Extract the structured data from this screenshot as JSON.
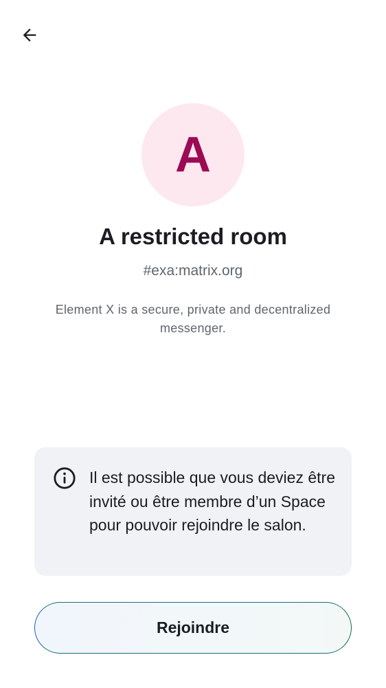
{
  "header": {
    "back_icon": "arrow-left-icon"
  },
  "room": {
    "avatar_letter": "A",
    "avatar_bg_color": "#fde8ef",
    "avatar_letter_color": "#9b0b53",
    "name": "A restricted room",
    "alias": "#exa:matrix.org",
    "description": "Element X is a secure, private and decentralized messenger."
  },
  "notice": {
    "icon": "info-icon",
    "text": "Il est possible que vous deviez être invité ou être membre d’un Space pour pouvoir rejoindre le salon."
  },
  "actions": {
    "join_label": "Rejoindre"
  }
}
